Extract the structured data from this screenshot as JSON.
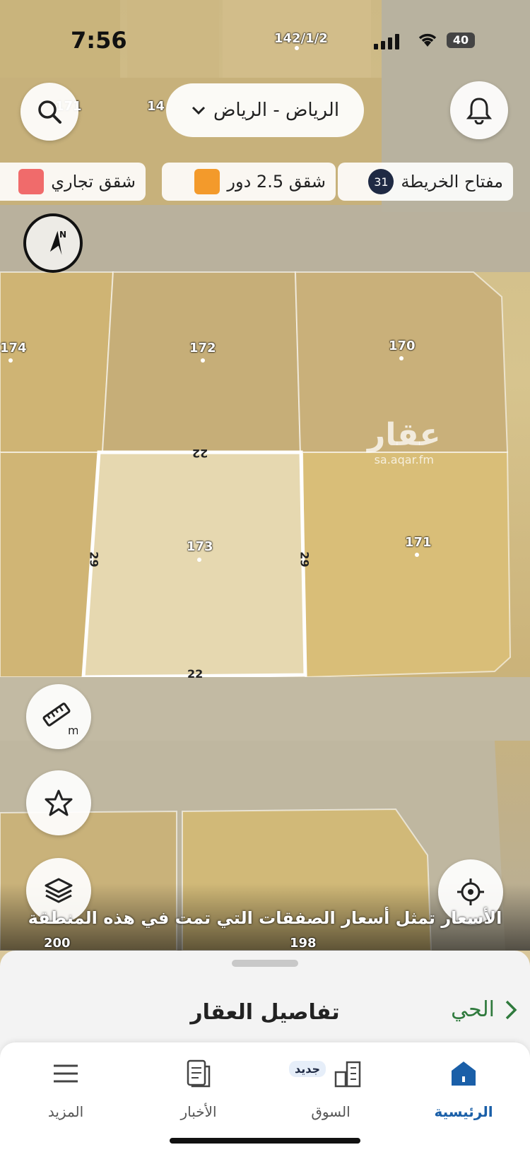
{
  "status_bar": {
    "time": "7:56",
    "battery": "40"
  },
  "header": {
    "city_selector": "الرياض - الرياض"
  },
  "legend": [
    {
      "label": "مفتاح الخريطة",
      "count": "31"
    },
    {
      "label": "شقق 2.5 دور",
      "color": "#f39a2b"
    },
    {
      "label": "شقق تجاري",
      "color": "#f06b6b"
    }
  ],
  "compass": {
    "letter": "N"
  },
  "map": {
    "watermark": "عقار",
    "watermark_url": "sa.aqar.fm",
    "plots": [
      "142/1/2",
      "171",
      "14",
      "174",
      "172",
      "170",
      "173",
      "171",
      "200",
      "198"
    ],
    "dimensions": [
      "22",
      "29",
      "29",
      "22"
    ],
    "ruler_unit": "m"
  },
  "price_note": "الأسعار تمثل أسعار الصفقات التي تمت في هذه المنطقة",
  "sheet": {
    "title": "تفاصيل العقار",
    "district": "الحي"
  },
  "tabs": [
    {
      "label": "الرئيسية",
      "active": true
    },
    {
      "label": "السوق",
      "badge": "جديد"
    },
    {
      "label": "الأخبار"
    },
    {
      "label": "المزيد"
    }
  ]
}
